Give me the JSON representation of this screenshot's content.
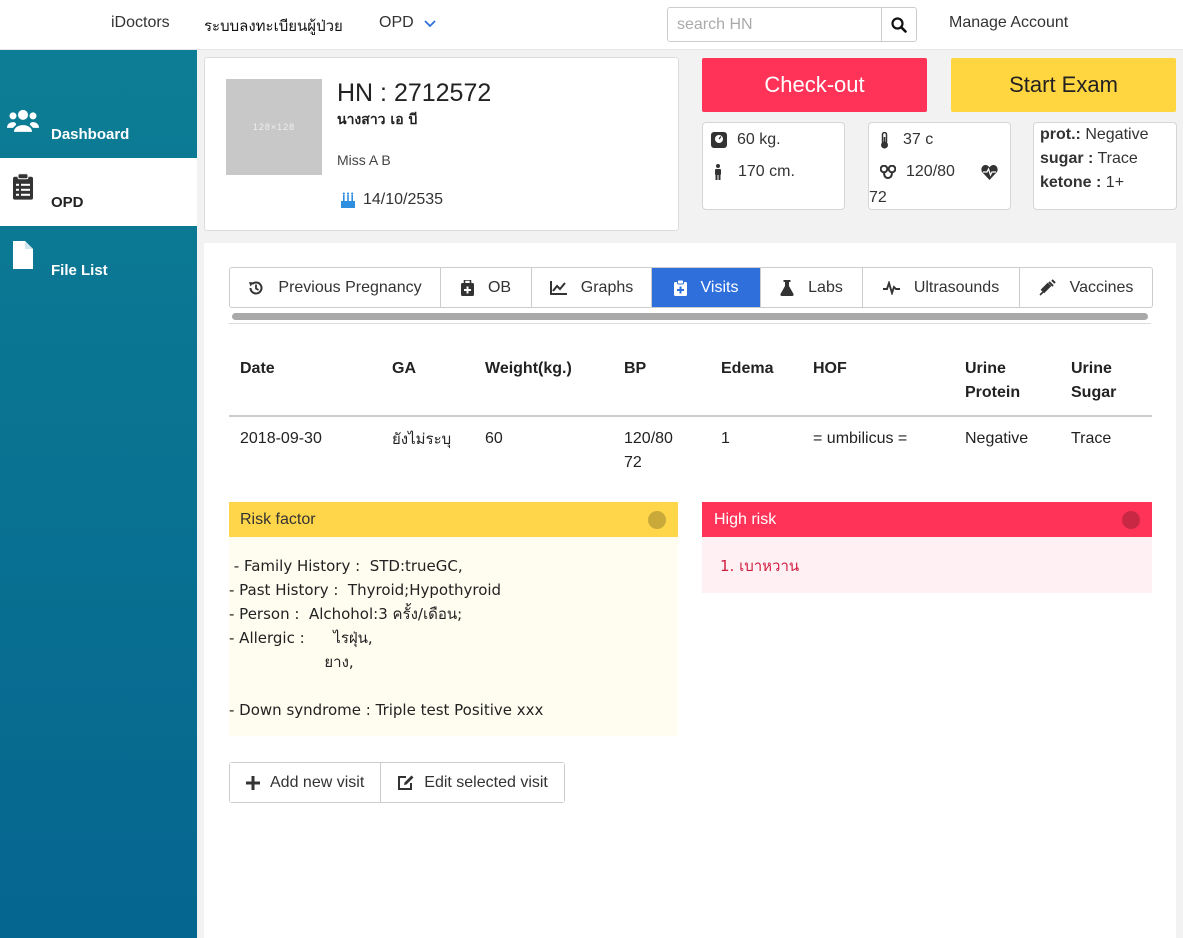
{
  "nav": {
    "brand": "iDoctors",
    "register": "ระบบลงทะเบียนผู้ป่วย",
    "opd": "OPD",
    "search_placeholder": "search HN",
    "manage": "Manage Account"
  },
  "sidebar": {
    "items": [
      {
        "label": "Dashboard",
        "icon": "users-icon"
      },
      {
        "label": "OPD",
        "icon": "clipboard-icon",
        "active": true
      },
      {
        "label": "File List",
        "icon": "file-icon"
      }
    ]
  },
  "patient": {
    "photo_placeholder": "128×128",
    "hn": "HN : 2712572",
    "thai_name": "นางสาว เอ บี",
    "eng_name": "Miss A B",
    "birthdate": "14/10/2535"
  },
  "actions": {
    "checkout": "Check-out",
    "start_exam": "Start Exam"
  },
  "vitals": {
    "weight": "60 kg.",
    "height": "170 cm.",
    "temp": "37 c",
    "bp": "120/80",
    "pulse": "72"
  },
  "urine": {
    "prot_label": "prot.:",
    "prot_value": "Negative",
    "sugar_label": "sugar :",
    "sugar_value": "Trace",
    "ketone_label": "ketone :",
    "ketone_value": "1+"
  },
  "tabs": [
    {
      "label": "Previous Pregnancy",
      "icon": "history-icon"
    },
    {
      "label": "OB",
      "icon": "medkit-icon"
    },
    {
      "label": "Graphs",
      "icon": "line-chart-icon"
    },
    {
      "label": "Visits",
      "icon": "medical-clipboard-icon",
      "active": true
    },
    {
      "label": "Labs",
      "icon": "flask-icon"
    },
    {
      "label": "Ultrasounds",
      "icon": "heartbeat-wave-icon"
    },
    {
      "label": "Vaccines",
      "icon": "syringe-icon"
    }
  ],
  "table": {
    "headers": [
      "Date",
      "GA",
      "Weight(kg.)",
      "BP",
      "Edema",
      "HOF",
      "Urine Protein",
      "Urine Sugar"
    ],
    "rows": [
      [
        "2018-09-30",
        "ยังไม่ระบุ",
        "60",
        "120/80 72",
        "1",
        "= umbilicus =",
        "Negative",
        "Trace"
      ]
    ]
  },
  "risk": {
    "title": "Risk factor",
    "lines": [
      " - Family History :  STD:trueGC,",
      "- Past History :  Thyroid;Hypothyroid",
      "- Person :  Alchohol:3 ครั้ง/เดือน;",
      "- Allergic :      ไรฝุ่น,",
      "                    ยาง,",
      "",
      "- Down syndrome : Triple test Positive xxx"
    ]
  },
  "high_risk": {
    "title": "High risk",
    "items": [
      "1.  เบาหวาน"
    ]
  },
  "buttons": {
    "add": "Add new visit",
    "edit": "Edit selected visit"
  },
  "colors": {
    "checkout": "#ff3358",
    "start_exam": "#ffd540",
    "active_tab": "#2e6fdb",
    "sidebar": "#0a7393"
  }
}
